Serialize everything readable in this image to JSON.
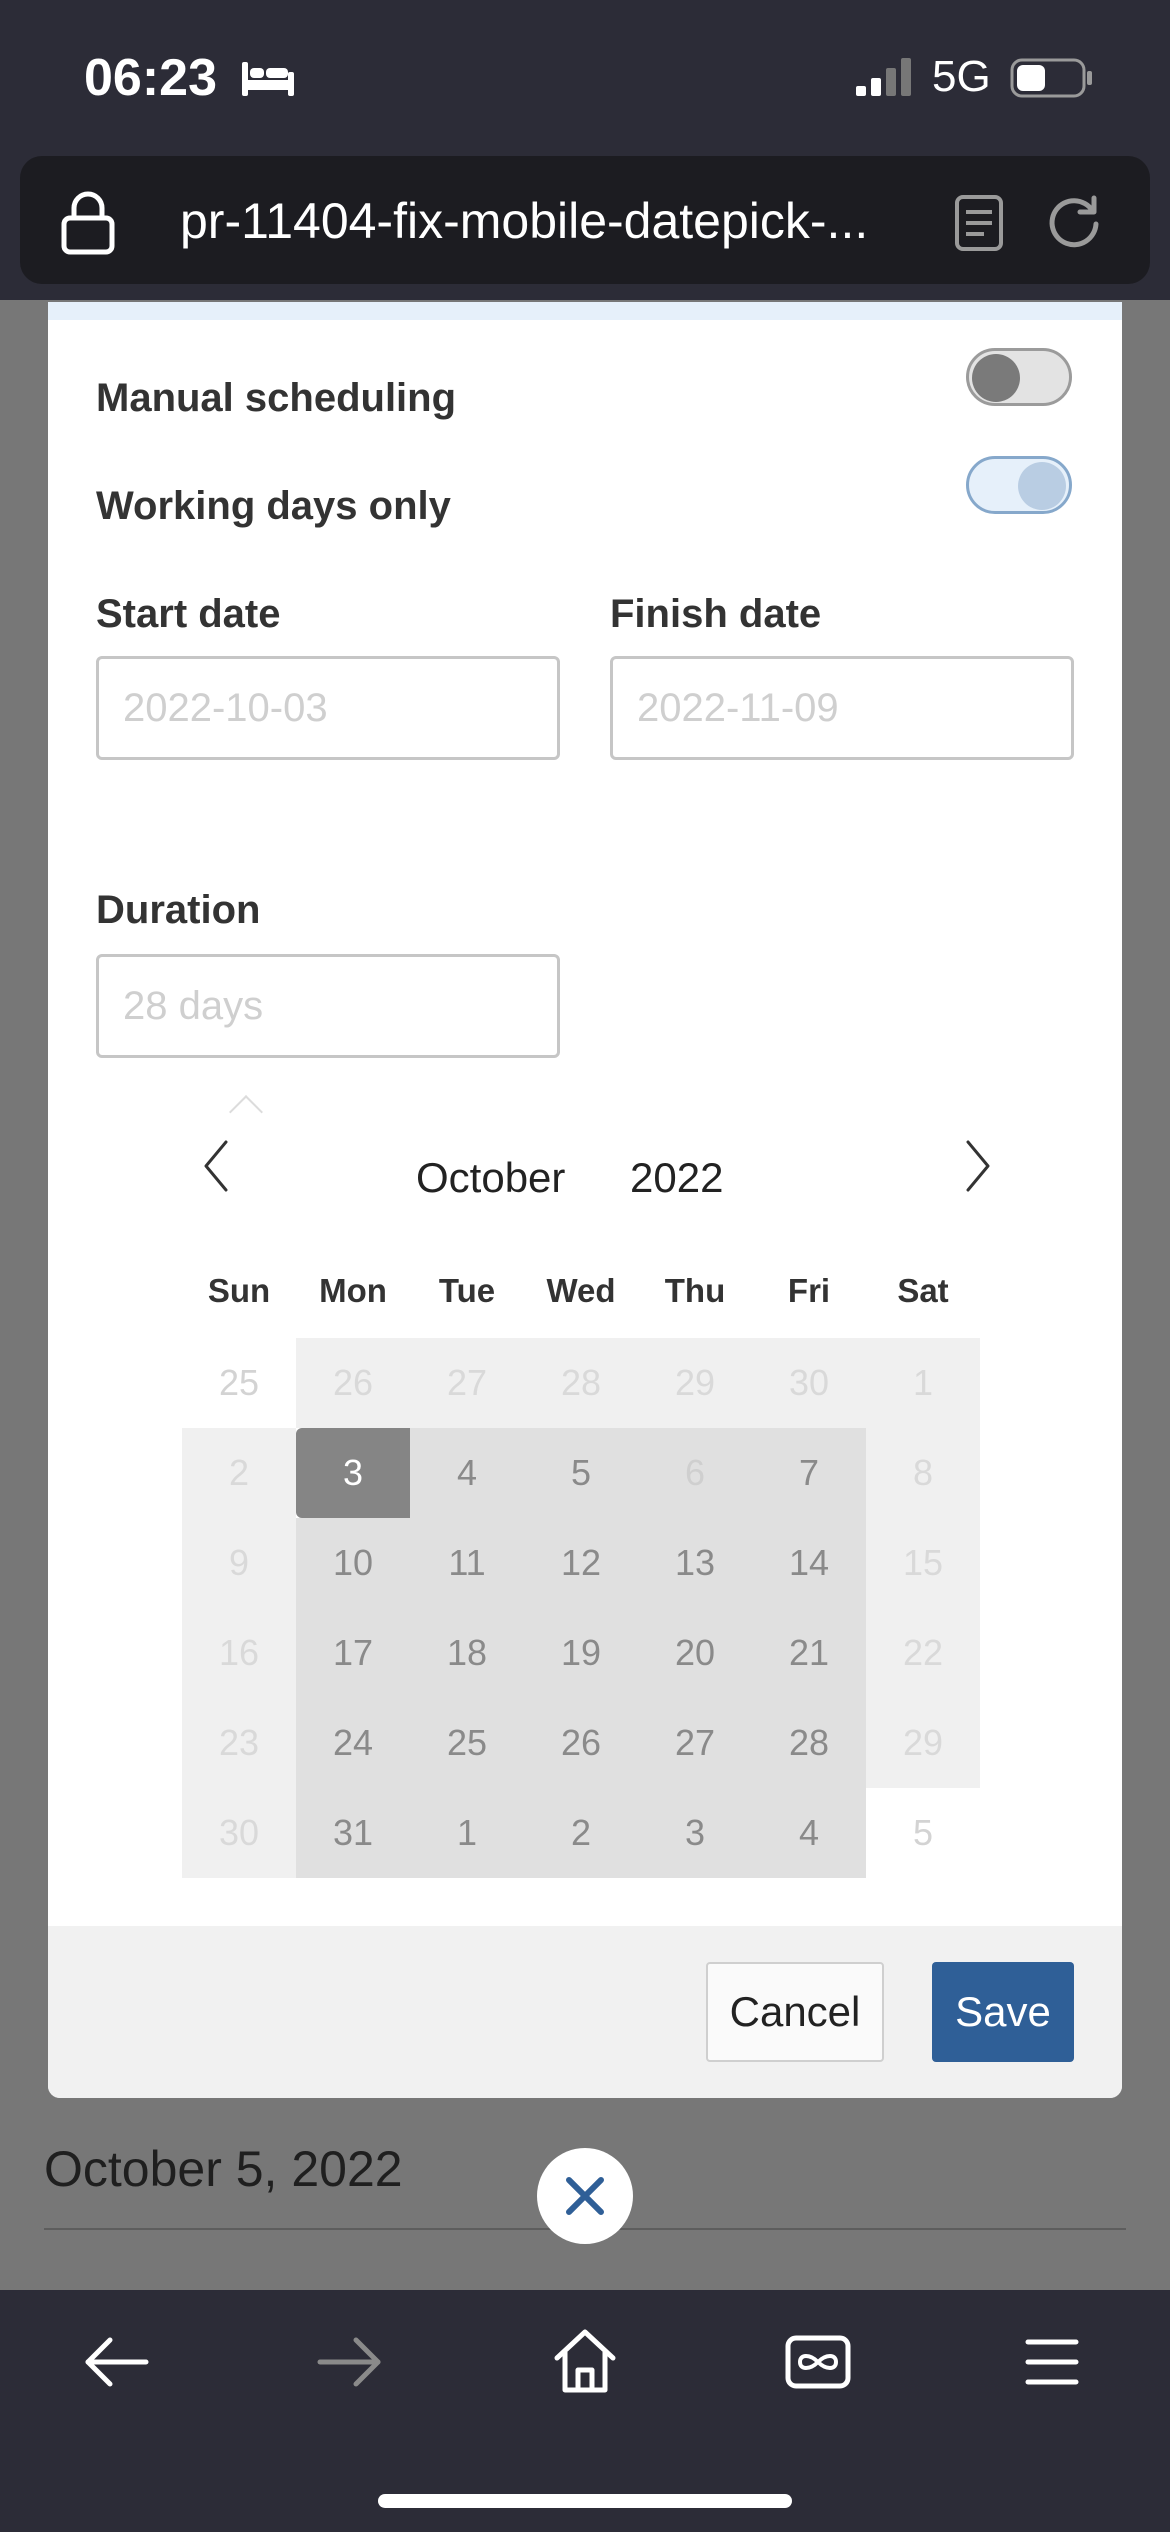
{
  "status_bar": {
    "time": "06:23",
    "network": "5G"
  },
  "url_bar": {
    "url": "pr-11404-fix-mobile-datepick-..."
  },
  "behind": {
    "date_text": "October 5, 2022"
  },
  "form": {
    "manual_scheduling": {
      "label": "Manual scheduling",
      "on": false
    },
    "working_days_only": {
      "label": "Working days only",
      "on": true
    },
    "start_date": {
      "label": "Start date",
      "placeholder": "2022-10-03"
    },
    "finish_date": {
      "label": "Finish date",
      "placeholder": "2022-11-09"
    },
    "duration": {
      "label": "Duration",
      "placeholder": "28 days"
    }
  },
  "calendar": {
    "month": "October",
    "year": "2022",
    "weekdays": [
      "Sun",
      "Mon",
      "Tue",
      "Wed",
      "Thu",
      "Fri",
      "Sat"
    ],
    "weeks": [
      [
        "25",
        "26",
        "27",
        "28",
        "29",
        "30",
        "1"
      ],
      [
        "2",
        "3",
        "4",
        "5",
        "6",
        "7",
        "8"
      ],
      [
        "9",
        "10",
        "11",
        "12",
        "13",
        "14",
        "15"
      ],
      [
        "16",
        "17",
        "18",
        "19",
        "20",
        "21",
        "22"
      ],
      [
        "23",
        "24",
        "25",
        "26",
        "27",
        "28",
        "29"
      ],
      [
        "30",
        "31",
        "1",
        "2",
        "3",
        "4",
        "5"
      ]
    ],
    "selected_day": "3",
    "non_working_day": "6"
  },
  "footer": {
    "cancel_label": "Cancel",
    "save_label": "Save"
  },
  "colors": {
    "accent": "#2f5f97",
    "selected_day": "#858585",
    "range_fill": "#e0e0e0"
  },
  "icons": {
    "status": [
      "bed-icon",
      "signal-icon",
      "battery-icon"
    ],
    "url_bar": [
      "lock-icon",
      "reader-icon",
      "reload-icon"
    ],
    "calendar": [
      "chevron-left-icon",
      "chevron-right-icon"
    ],
    "fab": "close-icon",
    "nav": [
      "back-arrow-icon",
      "forward-arrow-icon",
      "home-icon",
      "tabs-icon",
      "menu-icon"
    ]
  }
}
